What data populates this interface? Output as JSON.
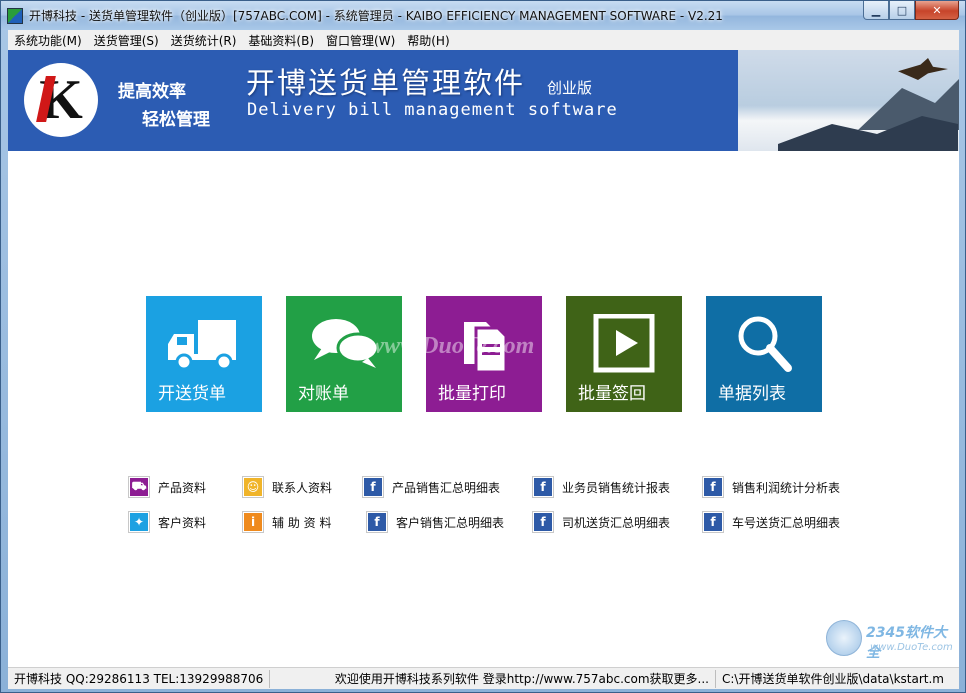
{
  "window": {
    "title": "开博科技 - 送货单管理软件（创业版）[757ABC.COM] - 系统管理员 - KAIBO EFFICIENCY MANAGEMENT SOFTWARE - V2.21",
    "min_glyph": "▁",
    "max_glyph": "□",
    "close_glyph": "✕"
  },
  "menu": {
    "items": [
      "系统功能(M)",
      "送货管理(S)",
      "送货统计(R)",
      "基础资料(B)",
      "窗口管理(W)",
      "帮助(H)"
    ]
  },
  "banner": {
    "logo_letter": "K",
    "slogan_line1": "提高效率",
    "slogan_line2": "轻松管理",
    "title": "开博送货单管理软件",
    "edition": "创业版",
    "subtitle": "Delivery bill management software"
  },
  "tiles": [
    {
      "label": "开送货单",
      "icon": "truck-icon",
      "color": "#1ba1e2"
    },
    {
      "label": "对账单",
      "icon": "chat-bubbles-icon",
      "color": "#22a046"
    },
    {
      "label": "批量打印",
      "icon": "documents-icon",
      "color": "#8d1d93"
    },
    {
      "label": "批量签回",
      "icon": "play-icon",
      "color": "#3f6317"
    },
    {
      "label": "单据列表",
      "icon": "search-icon",
      "color": "#0f6ea5"
    }
  ],
  "watermark": "www.DuoTe.com",
  "links": {
    "row1": [
      {
        "label": "产品资料",
        "icon": "cart-icon",
        "color": "#8d1d93"
      },
      {
        "label": "联系人资料",
        "icon": "contacts-icon",
        "color": "#f0b429"
      },
      {
        "label": "产品销售汇总明细表",
        "icon": "facebook-icon",
        "color": "#2e5aa7"
      },
      {
        "label": "业务员销售统计报表",
        "icon": "facebook-icon",
        "color": "#2e5aa7"
      },
      {
        "label": "销售利润统计分析表",
        "icon": "facebook-icon",
        "color": "#2e5aa7"
      }
    ],
    "row2": [
      {
        "label": "客户资料",
        "icon": "twitter-icon",
        "color": "#1da1e2"
      },
      {
        "label": "辅 助 资 料",
        "icon": "info-icon",
        "color": "#ef8a1d"
      },
      {
        "label": "客户销售汇总明细表",
        "icon": "facebook-icon",
        "color": "#2e5aa7"
      },
      {
        "label": "司机送货汇总明细表",
        "icon": "facebook-icon",
        "color": "#2e5aa7"
      },
      {
        "label": "车号送货汇总明细表",
        "icon": "facebook-icon",
        "color": "#2e5aa7"
      }
    ]
  },
  "corner_mark": {
    "brand": "2345软件大全",
    "url": "www.DuoTe.com"
  },
  "status": {
    "company": "开博科技 QQ:29286113 TEL:13929988706",
    "message": "欢迎使用开博科技系列软件   登录http://www.757abc.com获取更多...",
    "path": "C:\\开博送货单软件创业版\\data\\kstart.m"
  }
}
